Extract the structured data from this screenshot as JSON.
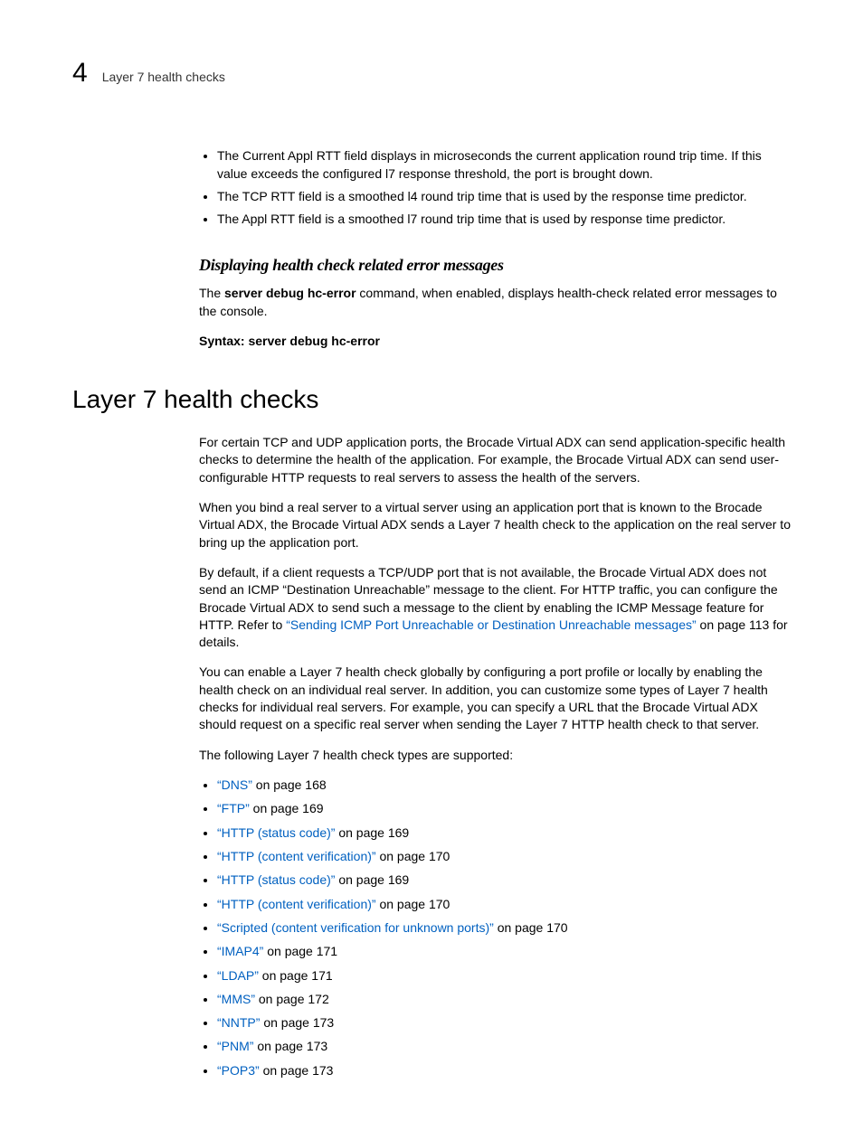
{
  "header": {
    "chapter_number": "4",
    "running_head": "Layer 7 health checks"
  },
  "top_bullets": [
    "The Current Appl RTT field displays in microseconds the current application round trip time. If this value exceeds the configured l7 response threshold, the port is brought down.",
    "The TCP RTT field is a smoothed l4 round trip time that is used by the response time predictor.",
    "The Appl RTT field is a smoothed l7 round trip time that is used by response time predictor."
  ],
  "sub1": {
    "heading": "Displaying health check related error messages",
    "para_pre": "The ",
    "para_cmd": "server debug hc-error",
    "para_post": " command, when enabled, displays health-check related error messages to the console.",
    "syntax_label": "Syntax:  ",
    "syntax_cmd": "server debug hc-error"
  },
  "section_title": "Layer 7 health checks",
  "paras": {
    "p1": "For certain TCP and UDP application ports, the Brocade Virtual ADX can send application-specific health checks to determine the health of the application. For example, the Brocade Virtual ADX can send user-configurable HTTP requests to real servers to assess the health of the servers.",
    "p2": "When you bind a real server to a virtual server using an application port that is known to the Brocade Virtual ADX, the Brocade Virtual ADX sends a Layer 7 health check to the application on the real server to bring up the application port.",
    "p3_pre": "By default, if a client requests a TCP/UDP port that is not available, the Brocade Virtual ADX does not send an ICMP “Destination Unreachable” message to the client. For HTTP traffic, you can configure the Brocade Virtual ADX to send such a message to the client by enabling the ICMP Message feature for HTTP. Refer to ",
    "p3_link": "“Sending ICMP Port Unreachable or Destination Unreachable messages”",
    "p3_post": " on page 113 for details.",
    "p4": "You can enable a Layer 7 health check globally by configuring a port profile or locally by enabling the health check on an individual real server. In addition, you can customize some types of Layer 7 health checks for individual real servers. For example, you can specify a URL that the Brocade Virtual ADX should request on a specific real server when sending the Layer 7 HTTP health check to that server.",
    "p5": "The following Layer 7 health check types are supported:"
  },
  "links": [
    {
      "label": "“DNS”",
      "suffix": " on page 168"
    },
    {
      "label": "“FTP”",
      "suffix": " on page 169"
    },
    {
      "label": "“HTTP (status code)”",
      "suffix": " on page 169"
    },
    {
      "label": "“HTTP (content verification)”",
      "suffix": " on page 170"
    },
    {
      "label": "“HTTP (status code)”",
      "suffix": " on page 169"
    },
    {
      "label": "“HTTP (content verification)”",
      "suffix": " on page 170"
    },
    {
      "label": "“Scripted (content verification for unknown ports)”",
      "suffix": " on page 170"
    },
    {
      "label": "“IMAP4”",
      "suffix": " on page 171"
    },
    {
      "label": "“LDAP”",
      "suffix": " on page 171"
    },
    {
      "label": "“MMS”",
      "suffix": " on page 172"
    },
    {
      "label": "“NNTP”",
      "suffix": " on page 173"
    },
    {
      "label": "“PNM”",
      "suffix": " on page 173"
    },
    {
      "label": "“POP3”",
      "suffix": " on page 173"
    }
  ]
}
